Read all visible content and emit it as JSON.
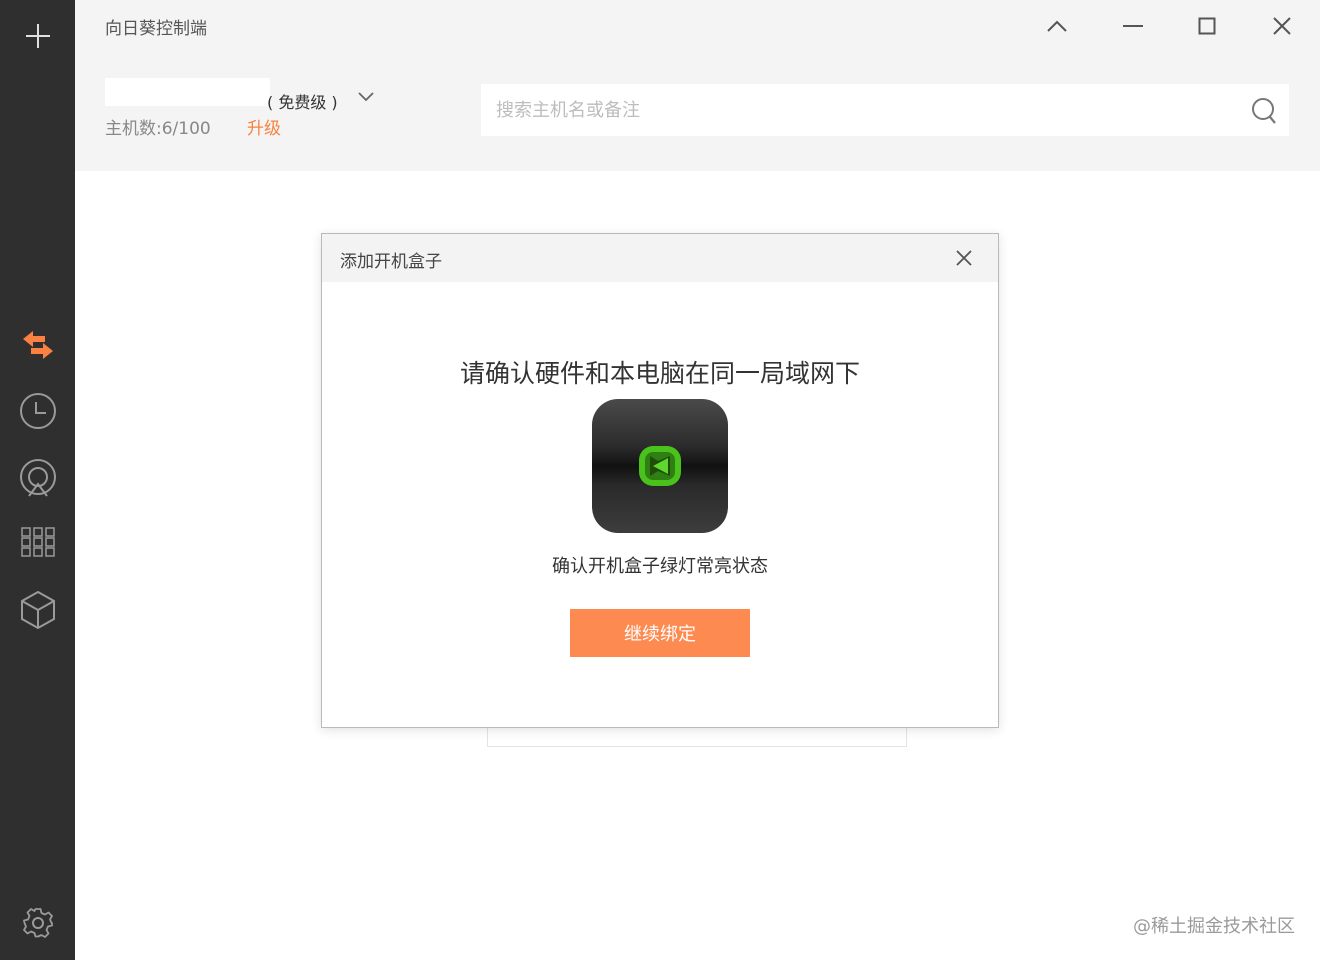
{
  "app": {
    "title": "向日葵控制端"
  },
  "sidebar": {
    "icons": [
      "plus-icon",
      "remote-control-icon",
      "history-icon",
      "discover-icon",
      "apps-grid-icon",
      "box-icon",
      "settings-icon"
    ],
    "active_color": "#fa8141"
  },
  "account": {
    "tier": "( 免费级 )",
    "host_count": "主机数:6/100",
    "upgrade": "升级"
  },
  "search": {
    "placeholder": "搜索主机名或备注"
  },
  "dialog": {
    "title": "添加开机盒子",
    "heading": "请确认硬件和本电脑在同一局域网下",
    "description": "确认开机盒子绿灯常亮状态",
    "confirm_label": "继续绑定"
  },
  "watermark": "@稀土掘金技术社区",
  "colors": {
    "accent": "#fa8141",
    "button": "#fd8a51",
    "sidebar": "#2f2f2f",
    "device_light": "#49c21b"
  }
}
